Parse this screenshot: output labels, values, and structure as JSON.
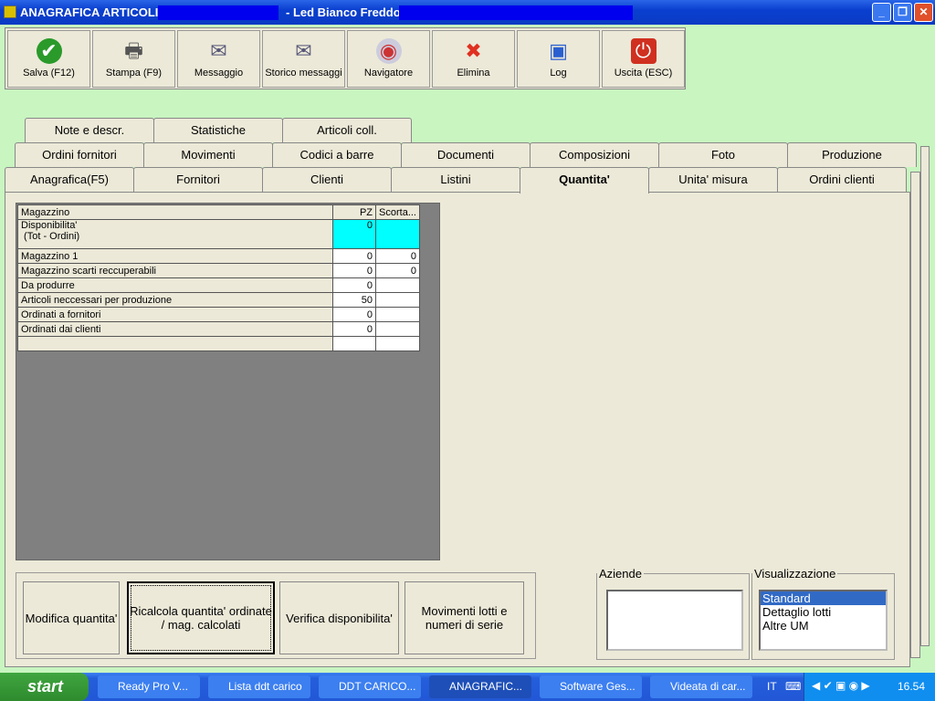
{
  "window": {
    "title_prefix": "ANAGRAFICA ARTICOLI -",
    "title_middle": "- Led Bianco Freddo"
  },
  "toolbar": [
    {
      "label": "Salva (F12)",
      "icon": "check-icon"
    },
    {
      "label": "Stampa (F9)",
      "icon": "printer-icon"
    },
    {
      "label": "Messaggio",
      "icon": "envelope-pen-icon"
    },
    {
      "label": "Storico messaggi",
      "icon": "envelope-search-icon"
    },
    {
      "label": "Navigatore",
      "icon": "compass-icon"
    },
    {
      "label": "Elimina",
      "icon": "x-icon"
    },
    {
      "label": "Log",
      "icon": "book-search-icon"
    },
    {
      "label": "Uscita (ESC)",
      "icon": "power-icon"
    }
  ],
  "tabs_row1": [
    "Note e descr.",
    "Statistiche",
    "Articoli coll."
  ],
  "tabs_row2": [
    "Ordini fornitori",
    "Movimenti",
    "Codici a barre",
    "Documenti",
    "Composizioni",
    "Foto",
    "Produzione"
  ],
  "tabs_row3": [
    "Anagrafica(F5)",
    "Fornitori",
    "Clienti",
    "Listini",
    "Quantita'",
    "Unita' misura",
    "Ordini clienti"
  ],
  "grid": {
    "headers": [
      "Magazzino",
      "PZ",
      "Scorta..."
    ],
    "rows": [
      [
        "Disponibilita'\n (Tot - Ordini)",
        "0",
        ""
      ],
      [
        "Magazzino 1",
        "0",
        "0"
      ],
      [
        "Magazzino scarti reccuperabili",
        "0",
        "0"
      ],
      [
        "Da produrre",
        "0",
        ""
      ],
      [
        "Articoli neccessari per produzione",
        "50",
        ""
      ],
      [
        "Ordinati a fornitori",
        "0",
        ""
      ],
      [
        "Ordinati dai clienti",
        "0",
        ""
      ],
      [
        "",
        "",
        ""
      ]
    ]
  },
  "buttons": [
    "Modifica quantita'",
    "Ricalcola quantita' ordinate / mag. calcolati",
    "Verifica disponibilita'",
    "Movimenti lotti e numeri di serie"
  ],
  "aziende": {
    "label": "Aziende"
  },
  "visualizzazione": {
    "label": "Visualizzazione",
    "options": [
      "Standard",
      "Dettaglio lotti",
      "Altre UM"
    ],
    "selected": "Standard"
  },
  "taskbar": {
    "start": "start",
    "tasks": [
      "Ready Pro V...",
      "Lista ddt carico",
      "DDT CARICO...",
      "ANAGRAFIC...",
      "Software Ges...",
      "Videata di car..."
    ],
    "lang": "IT",
    "clock": "16.54"
  }
}
